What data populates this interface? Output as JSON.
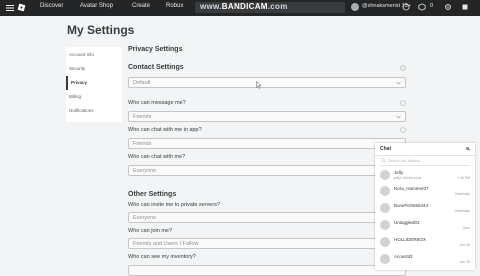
{
  "topbar": {
    "nav": [
      "Discover",
      "Avatar Shop",
      "Create",
      "Robux"
    ],
    "watermark_pre": "www.",
    "watermark_brand": "BANDICAM",
    "watermark_post": ".com",
    "username": "@shnaksmerist 13+",
    "robux": "0"
  },
  "page": {
    "title": "My Settings"
  },
  "sidebar": {
    "items": [
      {
        "label": "Account Info"
      },
      {
        "label": "Security"
      },
      {
        "label": "Privacy"
      },
      {
        "label": "Billing"
      },
      {
        "label": "Notifications"
      }
    ]
  },
  "privacy": {
    "heading": "Privacy Settings",
    "contact_heading": "Contact Settings",
    "contact_value": "Default",
    "message_label": "Who can message me?",
    "message_value": "Friends",
    "chat_app_label": "Who can chat with me in app?",
    "chat_app_value": "Friends",
    "chat_label": "Who can chat with me?",
    "chat_value": "Everyone",
    "other_heading": "Other Settings",
    "invite_label": "Who can invite me to private servers?",
    "invite_value": "Everyone",
    "join_label": "Who can join me?",
    "join_value": "Friends and Users I Follow",
    "inventory_label": "Who can see my inventory?"
  },
  "chat": {
    "title": "Chat",
    "search_placeholder": "Search for friends",
    "rows": [
      {
        "name": "Jelly",
        "msg": "jelly1 left the chat",
        "time": "7:46 PM"
      },
      {
        "name": "Nora_Hammer07",
        "msg": "",
        "time": "Yesterday"
      },
      {
        "name": "BoneFish555344",
        "msg": "",
        "time": "Yesterday"
      },
      {
        "name": "Untaggled03",
        "msg": "",
        "time": "Mon"
      },
      {
        "name": "HOLLIDERBOX",
        "msg": "",
        "time": "Jun 30"
      },
      {
        "name": "Acoustit3",
        "msg": "",
        "time": "Jun 28"
      }
    ]
  }
}
